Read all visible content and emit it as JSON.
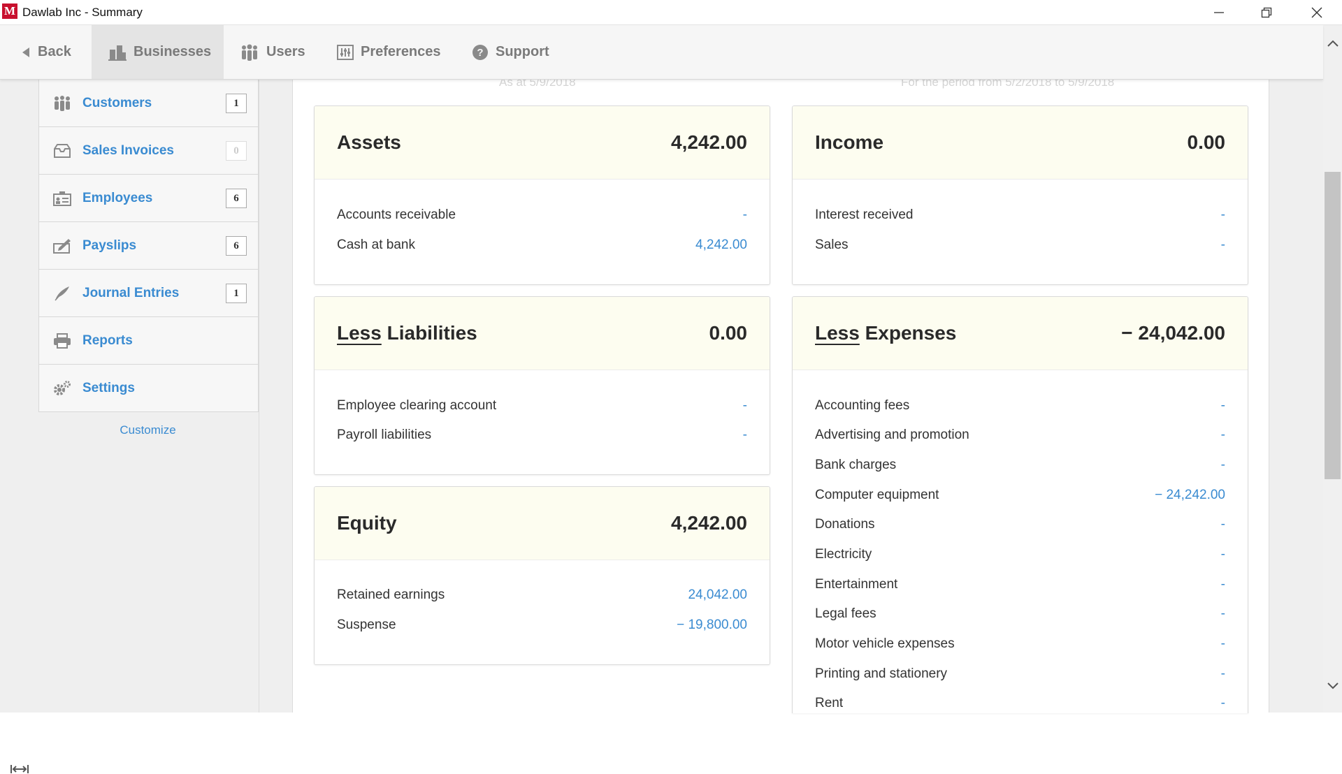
{
  "window": {
    "logo_letter": "M",
    "title": "Dawlab Inc - Summary"
  },
  "toolbar": {
    "back": "Back",
    "businesses": "Businesses",
    "users": "Users",
    "preferences": "Preferences",
    "support": "Support"
  },
  "nav": {
    "items": [
      {
        "label": "Customers",
        "count": "1",
        "icon": "customers-icon"
      },
      {
        "label": "Sales Invoices",
        "count": "0",
        "icon": "sales-invoices-icon"
      },
      {
        "label": "Employees",
        "count": "6",
        "icon": "employees-icon"
      },
      {
        "label": "Payslips",
        "count": "6",
        "icon": "payslips-icon"
      },
      {
        "label": "Journal Entries",
        "count": "1",
        "icon": "journal-entries-icon"
      },
      {
        "label": "Reports",
        "icon": "printer-icon"
      },
      {
        "label": "Settings",
        "icon": "gear-icon"
      }
    ],
    "customize": "Customize"
  },
  "balance_sheet": {
    "subheading": "As at 5/9/2018",
    "assets": {
      "title": "Assets",
      "total": "4,242.00",
      "rows": [
        {
          "label": "Accounts receivable",
          "value": "-"
        },
        {
          "label": "Cash at bank",
          "value": "4,242.00"
        }
      ]
    },
    "liabilities": {
      "less": "Less",
      "title": "Liabilities",
      "total": "0.00",
      "rows": [
        {
          "label": "Employee clearing account",
          "value": "-"
        },
        {
          "label": "Payroll liabilities",
          "value": "-"
        }
      ]
    },
    "equity": {
      "title": "Equity",
      "total": "4,242.00",
      "rows": [
        {
          "label": "Retained earnings",
          "value": "24,042.00"
        },
        {
          "label": "Suspense",
          "value": "− 19,800.00"
        }
      ]
    }
  },
  "profit_loss": {
    "subheading": "For the period from 5/2/2018 to 5/9/2018",
    "income": {
      "title": "Income",
      "total": "0.00",
      "rows": [
        {
          "label": "Interest received",
          "value": "-"
        },
        {
          "label": "Sales",
          "value": "-"
        }
      ]
    },
    "expenses": {
      "less": "Less",
      "title": "Expenses",
      "total": "− 24,042.00",
      "rows": [
        {
          "label": "Accounting fees",
          "value": "-"
        },
        {
          "label": "Advertising and promotion",
          "value": "-"
        },
        {
          "label": "Bank charges",
          "value": "-"
        },
        {
          "label": "Computer equipment",
          "value": "− 24,242.00"
        },
        {
          "label": "Donations",
          "value": "-"
        },
        {
          "label": "Electricity",
          "value": "-"
        },
        {
          "label": "Entertainment",
          "value": "-"
        },
        {
          "label": "Legal fees",
          "value": "-"
        },
        {
          "label": "Motor vehicle expenses",
          "value": "-"
        },
        {
          "label": "Printing and stationery",
          "value": "-"
        },
        {
          "label": "Rent",
          "value": "-"
        }
      ]
    }
  }
}
